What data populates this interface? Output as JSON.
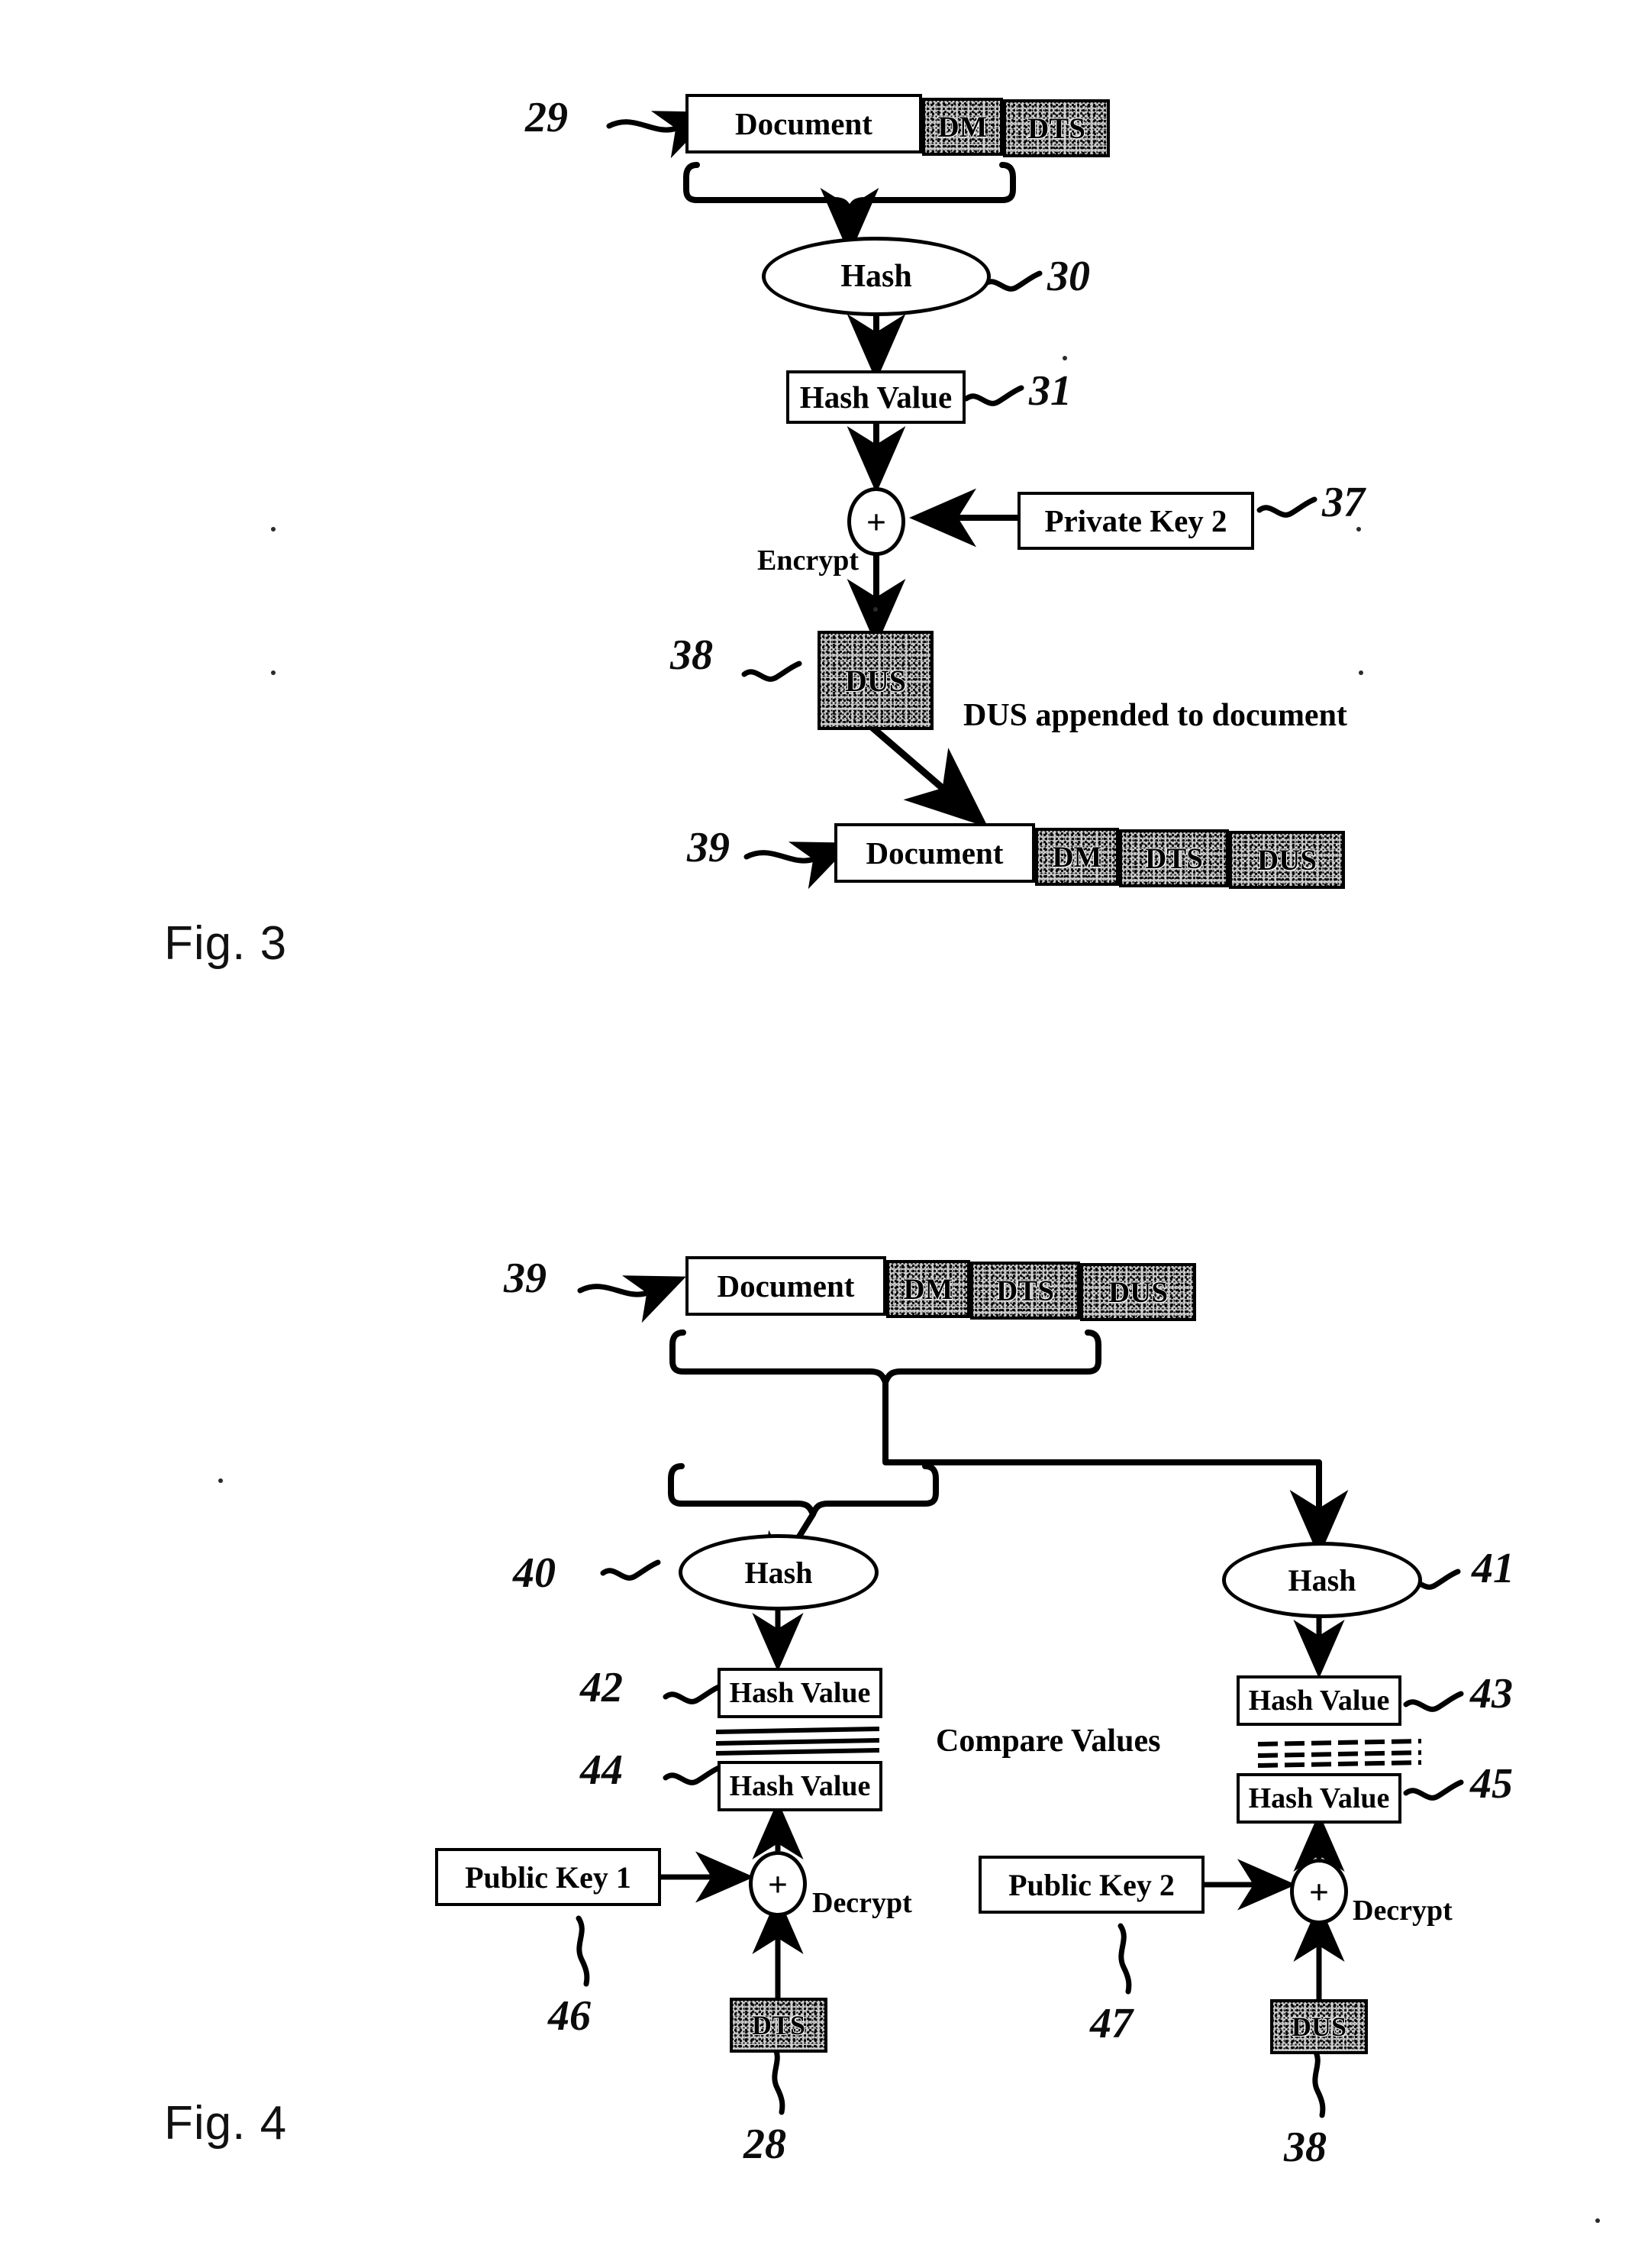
{
  "figures": [
    {
      "id": "fig3",
      "caption": "Fig. 3",
      "nodes": {
        "input_document": {
          "ref": "29",
          "segments": [
            "Document",
            "DM",
            "DTS"
          ]
        },
        "hash": {
          "ref": "30",
          "label": "Hash"
        },
        "hash_value": {
          "ref": "31",
          "label": "Hash Value"
        },
        "private_key": {
          "ref": "37",
          "label": "Private Key 2"
        },
        "operation": {
          "symbol": "+",
          "label": "Encrypt"
        },
        "signature": {
          "ref": "38",
          "label": "DUS"
        },
        "append_note": "DUS appended to document",
        "output_document": {
          "ref": "39",
          "segments": [
            "Document",
            "DM",
            "DTS",
            "DUS"
          ]
        }
      }
    },
    {
      "id": "fig4",
      "caption": "Fig. 4",
      "nodes": {
        "input_document": {
          "ref": "39",
          "segments": [
            "Document",
            "DM",
            "DTS",
            "DUS"
          ]
        },
        "hash_left": {
          "ref": "40",
          "label": "Hash"
        },
        "hash_right": {
          "ref": "41",
          "label": "Hash"
        },
        "hash_value_left_top": {
          "ref": "42",
          "label": "Hash Value"
        },
        "hash_value_right_top": {
          "ref": "43",
          "label": "Hash Value"
        },
        "hash_value_left_bottom": {
          "ref": "44",
          "label": "Hash Value"
        },
        "hash_value_right_bottom": {
          "ref": "45",
          "label": "Hash Value"
        },
        "compare_note": "Compare Values",
        "public_key_left": {
          "ref": "46",
          "label": "Public Key 1"
        },
        "public_key_right": {
          "ref": "47",
          "label": "Public Key 2"
        },
        "operation_left": {
          "symbol": "+",
          "label": "Decrypt"
        },
        "operation_right": {
          "symbol": "+",
          "label": "Decrypt"
        },
        "signature_left": {
          "ref": "28",
          "label": "DTS"
        },
        "signature_right": {
          "ref": "38",
          "label": "DUS"
        }
      }
    }
  ]
}
